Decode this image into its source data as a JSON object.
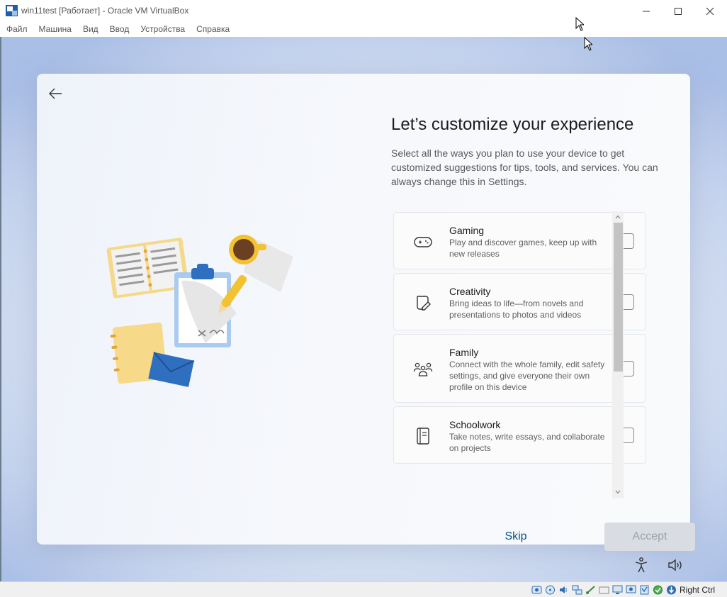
{
  "window": {
    "title": "win11test [Работает] - Oracle VM VirtualBox",
    "menu": [
      "Файл",
      "Машина",
      "Вид",
      "Ввод",
      "Устройства",
      "Справка"
    ]
  },
  "oobe": {
    "heading": "Let’s customize your experience",
    "description": "Select all the ways you plan to use your device to get customized suggestions for tips, tools, and services. You can always change this in Settings.",
    "options": [
      {
        "title": "Gaming",
        "desc": "Play and discover games, keep up with new releases",
        "icon": "gamepad-icon",
        "checked": false
      },
      {
        "title": "Creativity",
        "desc": "Bring ideas to life—from novels and presentations to photos and videos",
        "icon": "pen-paper-icon",
        "checked": false
      },
      {
        "title": "Family",
        "desc": "Connect with the whole family, edit safety settings, and give everyone their own profile on this device",
        "icon": "family-icon",
        "checked": false
      },
      {
        "title": "Schoolwork",
        "desc": "Take notes, write essays, and collaborate on projects",
        "icon": "notebook-icon",
        "checked": false
      }
    ],
    "skip_label": "Skip",
    "accept_label": "Accept"
  },
  "statusbar": {
    "host_key": "Right Ctrl"
  },
  "colors": {
    "accent": "#0b4f8a",
    "disabled_button": "#d9dde3"
  }
}
